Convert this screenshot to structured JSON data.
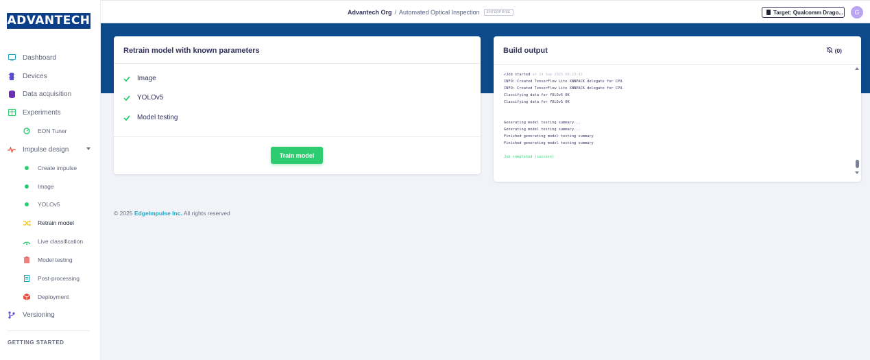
{
  "brand": {
    "logo_text": "ADVANTECH"
  },
  "header": {
    "org": "Advantech Org",
    "separator": "/",
    "project": "Automated Optical Inspection",
    "badge": "ENTERPRISE",
    "target_label": "Target: Qualcomm Drago...",
    "avatar_initial": "G"
  },
  "sidebar": {
    "items": [
      {
        "label": "Dashboard",
        "icon": "monitor-icon",
        "color": "#1ea7c5"
      },
      {
        "label": "Devices",
        "icon": "chip-icon",
        "color": "#5a4fcf"
      },
      {
        "label": "Data acquisition",
        "icon": "database-icon",
        "color": "#6b2fb3"
      },
      {
        "label": "Experiments",
        "icon": "table-icon",
        "color": "#2ecc71"
      },
      {
        "label": "EON Tuner",
        "icon": "tuner-icon",
        "color": "#2ecc71"
      },
      {
        "label": "Impulse design",
        "icon": "pulse-icon",
        "color": "#e74c3c"
      },
      {
        "label": "Create impulse",
        "icon": "dot-icon",
        "color": "#2ecc71"
      },
      {
        "label": "Image",
        "icon": "dot-icon",
        "color": "#2ecc71"
      },
      {
        "label": "YOLOv5",
        "icon": "dot-icon",
        "color": "#2ecc71"
      },
      {
        "label": "Retrain model",
        "icon": "shuffle-icon",
        "color": "#f1c40f"
      },
      {
        "label": "Live classification",
        "icon": "wifi-icon",
        "color": "#2ecc71"
      },
      {
        "label": "Model testing",
        "icon": "clipboard-icon",
        "color": "#f08080"
      },
      {
        "label": "Post-processing",
        "icon": "doc-icon",
        "color": "#1ea7c5"
      },
      {
        "label": "Deployment",
        "icon": "box-icon",
        "color": "#e74c3c"
      },
      {
        "label": "Versioning",
        "icon": "branch-icon",
        "color": "#5a4fcf"
      }
    ],
    "section_title": "GETTING STARTED"
  },
  "retrain": {
    "title": "Retrain model with known parameters",
    "steps": [
      "Image",
      "YOLOv5",
      "Model testing"
    ],
    "button": "Train model"
  },
  "build": {
    "title": "Build output",
    "notif_count": "(0)",
    "job_started": "Job started",
    "job_time": "at 24 Sep 2025 06:23:42",
    "lines1": [
      "INFO: Created TensorFlow Lite XNNPACK delegate for CPU.",
      "INFO: Created TensorFlow Lite XNNPACK delegate for CPU.",
      "Classifying data for YOLOv5 OK",
      "Classifying data for YOLOv5 OK"
    ],
    "lines2": [
      "Generating model testing summary...",
      "Generating model testing summary...",
      "Finished generating model testing summary",
      "Finished generating model testing summary"
    ],
    "completed": "Job completed (success)"
  },
  "footer": {
    "copyright": "© 2025",
    "company": "EdgeImpulse Inc.",
    "rights": "All rights reserved"
  }
}
